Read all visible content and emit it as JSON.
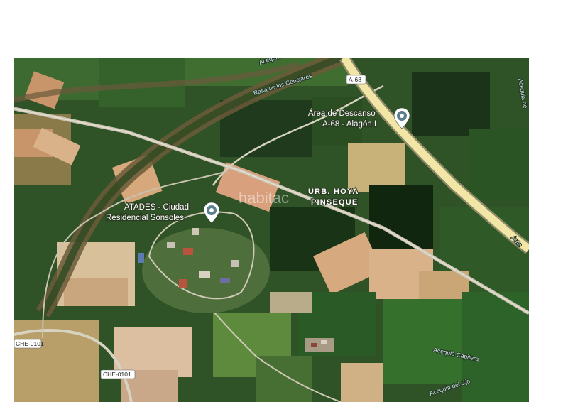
{
  "map": {
    "watermark": "habitac",
    "places": [
      {
        "line1": "Área de Descanso",
        "line2": "A-68 - Alagón I"
      },
      {
        "line1": "ATADES - Ciudad",
        "line2": "Residencial Sonsoles"
      }
    ],
    "area_label": {
      "line1": "URB. HOYA",
      "line2": "PINSEQUE"
    },
    "road_shields": [
      "A-68",
      "CHE-0101",
      "CHE-0101"
    ],
    "road_labels": [
      "Auto"
    ],
    "water_labels": [
      "Acequia",
      "Rasa de los Cencjares",
      "Acequia de",
      "Acequia Capitera",
      "Acequia del Cjo"
    ],
    "colors": {
      "farmland_dark": "#1f3a1c",
      "farmland_green": "#3b6a2c",
      "fallow": "#d9b28a",
      "motorway": "#f2e6a6",
      "pin": "#5b7f8c"
    }
  }
}
